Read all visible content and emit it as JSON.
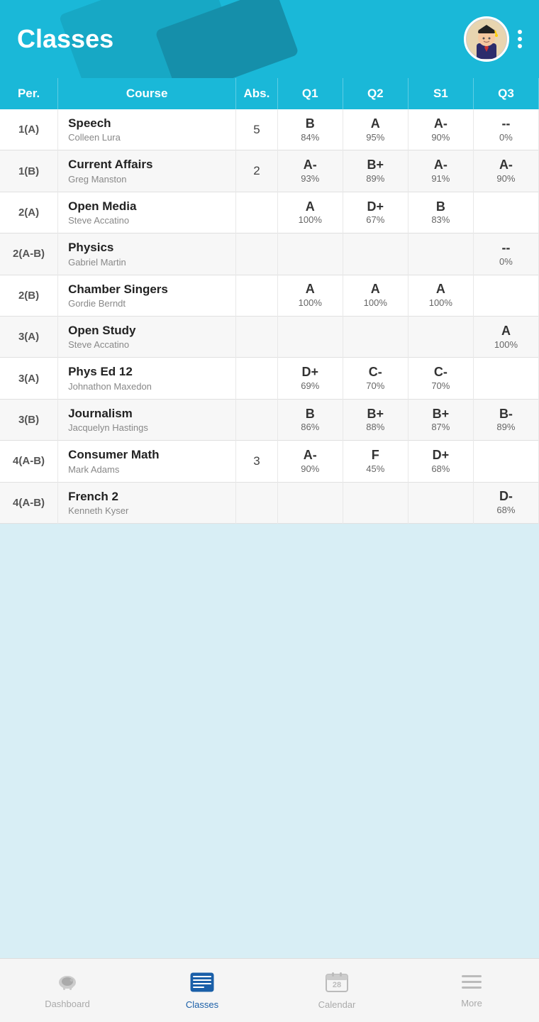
{
  "header": {
    "title": "Classes",
    "avatar_alt": "Student avatar"
  },
  "table": {
    "columns": [
      "Per.",
      "Course",
      "Abs.",
      "Q1",
      "Q2",
      "S1",
      "Q3"
    ],
    "rows": [
      {
        "period": "1(A)",
        "course": "Speech",
        "teacher": "Colleen Lura",
        "abs": "5",
        "q1_letter": "B",
        "q1_pct": "84%",
        "q2_letter": "A",
        "q2_pct": "95%",
        "s1_letter": "A-",
        "s1_pct": "90%",
        "q3_letter": "--",
        "q3_pct": "0%"
      },
      {
        "period": "1(B)",
        "course": "Current Affairs",
        "teacher": "Greg Manston",
        "abs": "2",
        "q1_letter": "A-",
        "q1_pct": "93%",
        "q2_letter": "B+",
        "q2_pct": "89%",
        "s1_letter": "A-",
        "s1_pct": "91%",
        "q3_letter": "A-",
        "q3_pct": "90%"
      },
      {
        "period": "2(A)",
        "course": "Open Media",
        "teacher": "Steve Accatino",
        "abs": "",
        "q1_letter": "A",
        "q1_pct": "100%",
        "q2_letter": "D+",
        "q2_pct": "67%",
        "s1_letter": "B",
        "s1_pct": "83%",
        "q3_letter": "",
        "q3_pct": ""
      },
      {
        "period": "2(A-B)",
        "course": "Physics",
        "teacher": "Gabriel Martin",
        "abs": "",
        "q1_letter": "",
        "q1_pct": "",
        "q2_letter": "",
        "q2_pct": "",
        "s1_letter": "",
        "s1_pct": "",
        "q3_letter": "--",
        "q3_pct": "0%"
      },
      {
        "period": "2(B)",
        "course": "Chamber Singers",
        "teacher": "Gordie Berndt",
        "abs": "",
        "q1_letter": "A",
        "q1_pct": "100%",
        "q2_letter": "A",
        "q2_pct": "100%",
        "s1_letter": "A",
        "s1_pct": "100%",
        "q3_letter": "",
        "q3_pct": ""
      },
      {
        "period": "3(A)",
        "course": "Open Study",
        "teacher": "Steve Accatino",
        "abs": "",
        "q1_letter": "",
        "q1_pct": "",
        "q2_letter": "",
        "q2_pct": "",
        "s1_letter": "",
        "s1_pct": "",
        "q3_letter": "A",
        "q3_pct": "100%"
      },
      {
        "period": "3(A)",
        "course": "Phys Ed 12",
        "teacher": "Johnathon Maxedon",
        "abs": "",
        "q1_letter": "D+",
        "q1_pct": "69%",
        "q2_letter": "C-",
        "q2_pct": "70%",
        "s1_letter": "C-",
        "s1_pct": "70%",
        "q3_letter": "",
        "q3_pct": ""
      },
      {
        "period": "3(B)",
        "course": "Journalism",
        "teacher": "Jacquelyn Hastings",
        "abs": "",
        "q1_letter": "B",
        "q1_pct": "86%",
        "q2_letter": "B+",
        "q2_pct": "88%",
        "s1_letter": "B+",
        "s1_pct": "87%",
        "q3_letter": "B-",
        "q3_pct": "89%"
      },
      {
        "period": "4(A-B)",
        "course": "Consumer Math",
        "teacher": "Mark Adams",
        "abs": "3",
        "q1_letter": "A-",
        "q1_pct": "90%",
        "q2_letter": "F",
        "q2_pct": "45%",
        "s1_letter": "D+",
        "s1_pct": "68%",
        "q3_letter": "",
        "q3_pct": ""
      },
      {
        "period": "4(A-B)",
        "course": "French 2",
        "teacher": "Kenneth Kyser",
        "abs": "",
        "q1_letter": "",
        "q1_pct": "",
        "q2_letter": "",
        "q2_pct": "",
        "s1_letter": "",
        "s1_pct": "",
        "q3_letter": "D-",
        "q3_pct": "68%"
      }
    ]
  },
  "nav": {
    "items": [
      {
        "label": "Dashboard",
        "icon": "dashboard",
        "active": false
      },
      {
        "label": "Classes",
        "icon": "classes",
        "active": true
      },
      {
        "label": "Calendar",
        "icon": "calendar",
        "active": false
      },
      {
        "label": "More",
        "icon": "more",
        "active": false
      }
    ]
  }
}
